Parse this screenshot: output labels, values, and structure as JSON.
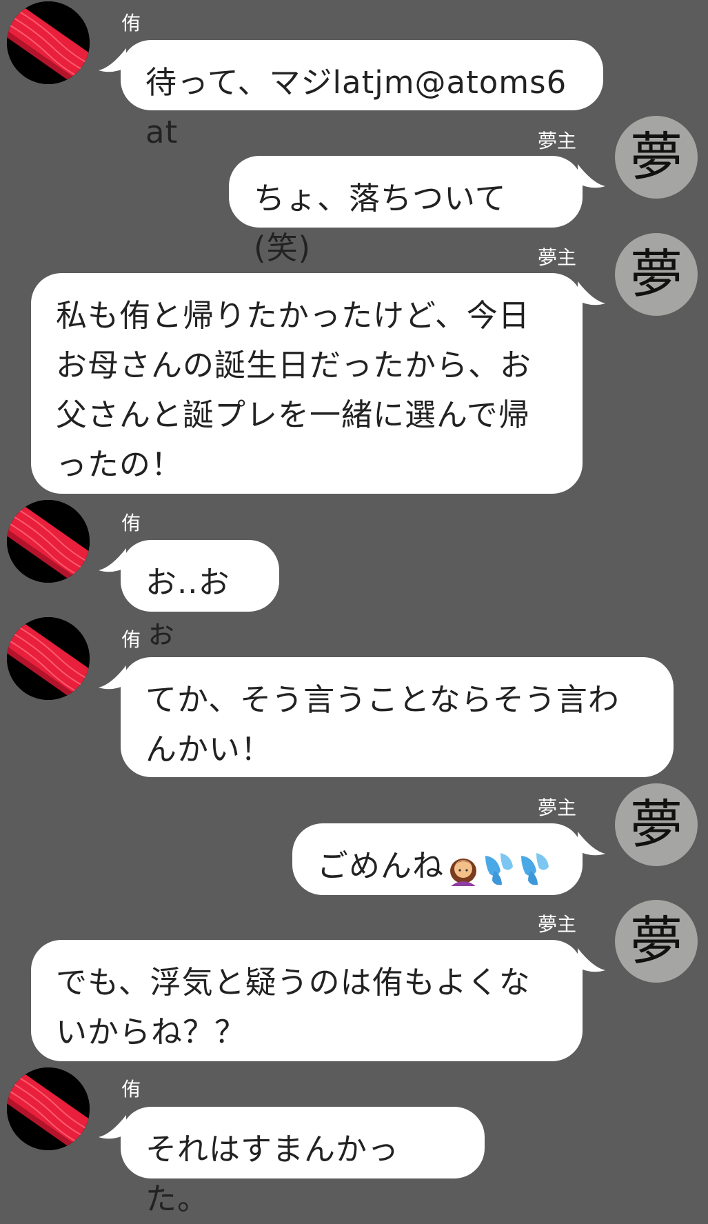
{
  "colors": {
    "background": "#5b5c5b",
    "bubble": "#ffffff",
    "text": "#222222",
    "yume_avatar": "#a5a5a3",
    "tuna_avatar_red": "#e8203c"
  },
  "participants": {
    "left_name": "侑",
    "right_name": "夢主",
    "right_avatar_char": "夢",
    "left_avatar_icon": "tuna-sashimi-icon"
  },
  "messages": [
    {
      "side": "left",
      "name": "侑",
      "text": "待って、マジlatjm@atoms6at"
    },
    {
      "side": "right",
      "name": "夢主",
      "text": "ちょ、落ちついて(笑)"
    },
    {
      "side": "right",
      "name": "夢主",
      "text": "私も侑と帰りたかったけど、今日お母さんの誕生日だったから、お父さんと誕プレを一緒に選んで帰ったの！"
    },
    {
      "side": "left",
      "name": "侑",
      "text": "お..おぉ"
    },
    {
      "side": "left",
      "name": "侑",
      "text": "てか、そう言うことならそう言わんかい！"
    },
    {
      "side": "right",
      "name": "夢主",
      "text": "ごめんね",
      "emoji": [
        "person-bowing-icon",
        "sweat-droplets-icon",
        "sweat-droplets-icon"
      ]
    },
    {
      "side": "right",
      "name": "夢主",
      "text": "でも、浮気と疑うのは侑もよくないからね？？"
    },
    {
      "side": "left",
      "name": "侑",
      "text": "それはすまんかった。"
    }
  ]
}
